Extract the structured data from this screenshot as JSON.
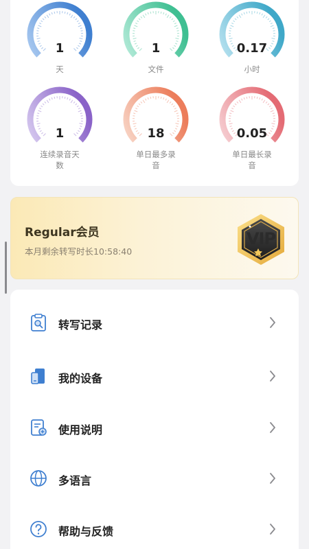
{
  "stats": [
    {
      "value": "1",
      "label": "天",
      "color_start": "#a9c9f0",
      "color_end": "#3f7fd0"
    },
    {
      "value": "1",
      "label": "文件",
      "color_start": "#b3ead8",
      "color_end": "#3fbf92"
    },
    {
      "value": "0.17",
      "label": "小时",
      "color_start": "#b6e1ef",
      "color_end": "#3fa8c8"
    },
    {
      "value": "1",
      "label": "连续录音天数",
      "color_start": "#d6c9ef",
      "color_end": "#8a63c8"
    },
    {
      "value": "18",
      "label": "单日最多录音",
      "color_start": "#f8d5c6",
      "color_end": "#ec7d5b"
    },
    {
      "value": "0.05",
      "label": "单日最长录音",
      "color_start": "#f6cfd3",
      "color_end": "#e46b74"
    }
  ],
  "vip": {
    "title": "Regular会员",
    "subtitle": "本月剩余转写时长10:58:40",
    "badge_text": "VIP"
  },
  "menu": [
    {
      "label": "转写记录",
      "icon": "transcript-record-icon"
    },
    {
      "label": "我的设备",
      "icon": "device-icon"
    },
    {
      "label": "使用说明",
      "icon": "manual-icon"
    },
    {
      "label": "多语言",
      "icon": "globe-icon"
    },
    {
      "label": "帮助与反馈",
      "icon": "help-icon"
    }
  ],
  "colors": {
    "accent_blue": "#3f7fd0",
    "vip_gold": "#f3c85a"
  }
}
